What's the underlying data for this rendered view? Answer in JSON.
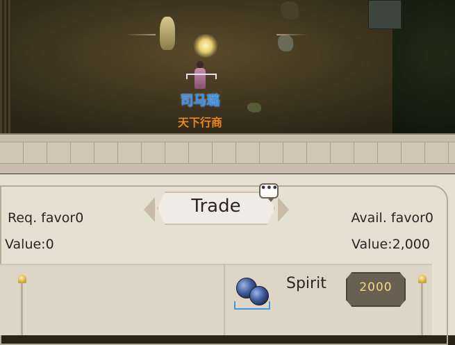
{
  "scene": {
    "npc_name": "司马璐",
    "npc_title": "天下行商"
  },
  "panel": {
    "title": "Trade",
    "chat_icon_glyph": "•••",
    "req_favor": "Req. favor0",
    "value_left": "Value:0",
    "avail_favor": "Avail. favor0",
    "value_right": "Value:2,000"
  },
  "item": {
    "name": "Spirit",
    "price": "2000",
    "icon": "blueberry-icon"
  },
  "colors": {
    "npc_name": "#3e8fe0",
    "npc_title": "#e08a2a",
    "price": "#f4d88a"
  }
}
